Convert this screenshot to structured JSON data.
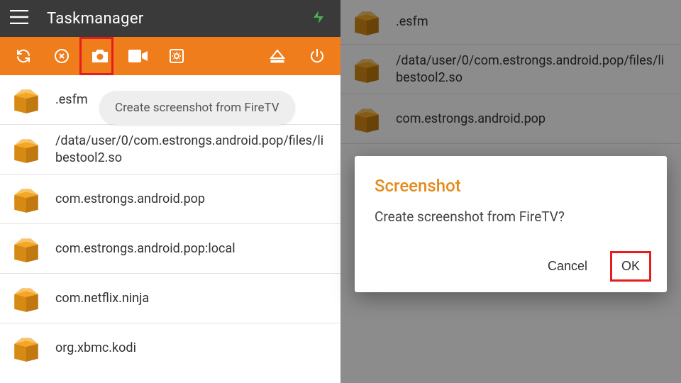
{
  "header": {
    "title": "Taskmanager"
  },
  "toolbar": {
    "icons": [
      "refresh",
      "close-circle",
      "camera",
      "video",
      "settings-box",
      "eject",
      "power"
    ]
  },
  "tooltip": {
    "text": "Create screenshot from FireTV"
  },
  "list_left": [
    ".esfm",
    "/data/user/0/com.estrongs.android.pop/files/libestool2.so",
    "com.estrongs.android.pop",
    "com.estrongs.android.pop:local",
    "com.netflix.ninja",
    "org.xbmc.kodi"
  ],
  "list_right": [
    ".esfm",
    "/data/user/0/com.estrongs.android.pop/files/libestool2.so",
    "com.estrongs.android.pop"
  ],
  "dialog": {
    "title": "Screenshot",
    "message": "Create screenshot from FireTV?",
    "cancel": "Cancel",
    "ok": "OK"
  }
}
